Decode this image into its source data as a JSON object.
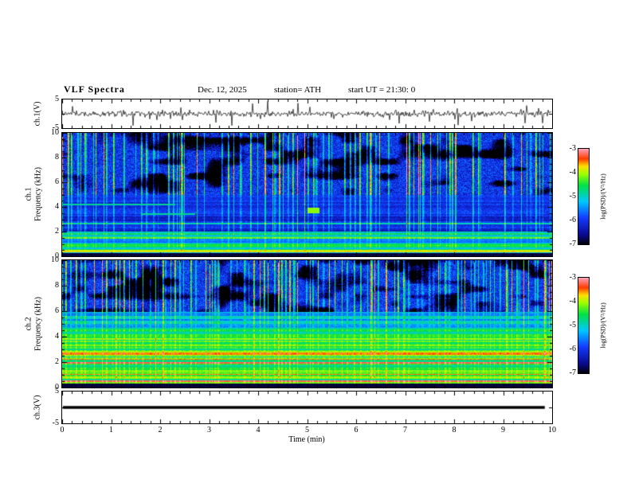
{
  "header": {
    "title": "VLF Spectra",
    "date": "Dec. 12, 2025",
    "station_label": "station= ATH",
    "start_ut_label": "start UT =  21:30: 0"
  },
  "xaxis": {
    "label": "Time (min)",
    "ticks": [
      "0",
      "1",
      "2",
      "3",
      "4",
      "5",
      "6",
      "7",
      "8",
      "9",
      "10"
    ],
    "range": [
      0,
      10
    ]
  },
  "panels": {
    "ch1_wave": {
      "ylabel": "ch.1(V)",
      "yticks": [
        "5",
        "-5"
      ],
      "ylim": [
        -5,
        5
      ]
    },
    "ch1_spec": {
      "ylabel_channel": "ch.1",
      "ylabel_axis": "Frequency (kHz)",
      "yticks": [
        "10",
        "8",
        "6",
        "4",
        "2",
        "0"
      ],
      "ylim": [
        0,
        10
      ]
    },
    "ch2_spec": {
      "ylabel_channel": "ch.2",
      "ylabel_axis": "Frequency (kHz)",
      "yticks": [
        "10",
        "8",
        "6",
        "4",
        "2",
        "0"
      ],
      "ylim": [
        0,
        10
      ]
    },
    "ch3_wave": {
      "ylabel": "ch.3(V)",
      "yticks": [
        "5",
        "-5"
      ],
      "ylim": [
        -5,
        5
      ]
    }
  },
  "colorbar": {
    "label": "log(PSD)/(V²/Hz)",
    "ticks": [
      "-3",
      "-4",
      "-5",
      "-6",
      "-7"
    ],
    "range": [
      -7,
      -3
    ]
  },
  "chart_data": [
    {
      "type": "line",
      "name": "ch1_waveform",
      "xlabel": "Time (min)",
      "ylabel": "ch.1(V)",
      "xlim": [
        0,
        10
      ],
      "ylim": [
        -5,
        5
      ],
      "description": "Channel-1 voltage record: continuous broadband noise of roughly ±0.5 V with frequent impulsive sferic spikes reaching ±2 to ±4 V over the 10-minute window.",
      "render_params": {
        "seed": 99,
        "noise_amp": 0.9,
        "spike_prob": 0.045,
        "spike_amp_max": 4.0
      }
    },
    {
      "type": "heatmap",
      "name": "ch1_spectrogram",
      "xlabel": "Time (min)",
      "ylabel": "ch.1 Frequency (kHz)",
      "xlim": [
        0,
        10
      ],
      "ylim": [
        0,
        10
      ],
      "zlabel": "log(PSD)/(V²/Hz)",
      "zlim": [
        -7,
        -3
      ],
      "colormap": "jet-with-black-base",
      "features": {
        "high_band": {
          "f_range": [
            5,
            10
          ],
          "base_level": -6.0,
          "dark_patch_level": -7,
          "streak_peak_level": -4.2
        },
        "mid_band": {
          "f_range": [
            2,
            5
          ],
          "base_level": -6.05,
          "thin_line_level": -4.95
        },
        "low_band": {
          "f_range": [
            0.32,
            2
          ],
          "base_level": -4.9,
          "stripe_spread": 1.5
        },
        "bottom_band": {
          "f_range": [
            0,
            0.32
          ],
          "level": -6.9
        },
        "red_line_khz": 0.42,
        "cyan_segments": [
          {
            "f": 3.45,
            "t": [
              1.6,
              2.7
            ]
          },
          {
            "f": 4.2,
            "t": [
              0.0,
              2.3
            ]
          }
        ],
        "bright_blob": {
          "f": [
            3.5,
            3.95
          ],
          "t": [
            5.0,
            5.25
          ]
        },
        "streak_seed": 7
      }
    },
    {
      "type": "heatmap",
      "name": "ch2_spectrogram",
      "xlabel": "Time (min)",
      "ylabel": "ch.2 Frequency (kHz)",
      "xlim": [
        0,
        10
      ],
      "ylim": [
        0,
        10
      ],
      "zlabel": "log(PSD)/(V²/Hz)",
      "zlim": [
        -7,
        -3
      ],
      "colormap": "jet-with-black-base",
      "features": {
        "high_band": {
          "f_range": [
            6,
            10
          ],
          "base_level": -5.95,
          "dark_patch_level": -7,
          "streak_peak_level": -4.2
        },
        "mid_band": {
          "f_range": [
            4.7,
            6
          ],
          "base_level": -5.3
        },
        "low_band": {
          "f_range": [
            0.32,
            4.7
          ],
          "base_level": -4.5,
          "yellow_line_level": -3.55,
          "dark_line_level": -5.9
        },
        "bottom_band": {
          "f_range": [
            0,
            0.32
          ],
          "level": -6.9
        },
        "red_lines_khz": [
          0.55,
          1.95
        ],
        "streak_seed": 23
      }
    },
    {
      "type": "line",
      "name": "ch3_waveform",
      "xlabel": "Time (min)",
      "ylabel": "ch.3(V)",
      "xlim": [
        0,
        10
      ],
      "ylim": [
        -5,
        5
      ],
      "constant_value": 0,
      "description": "Channel-3 voltage: flat heavy line at 0 V (no signal) across the record."
    }
  ]
}
